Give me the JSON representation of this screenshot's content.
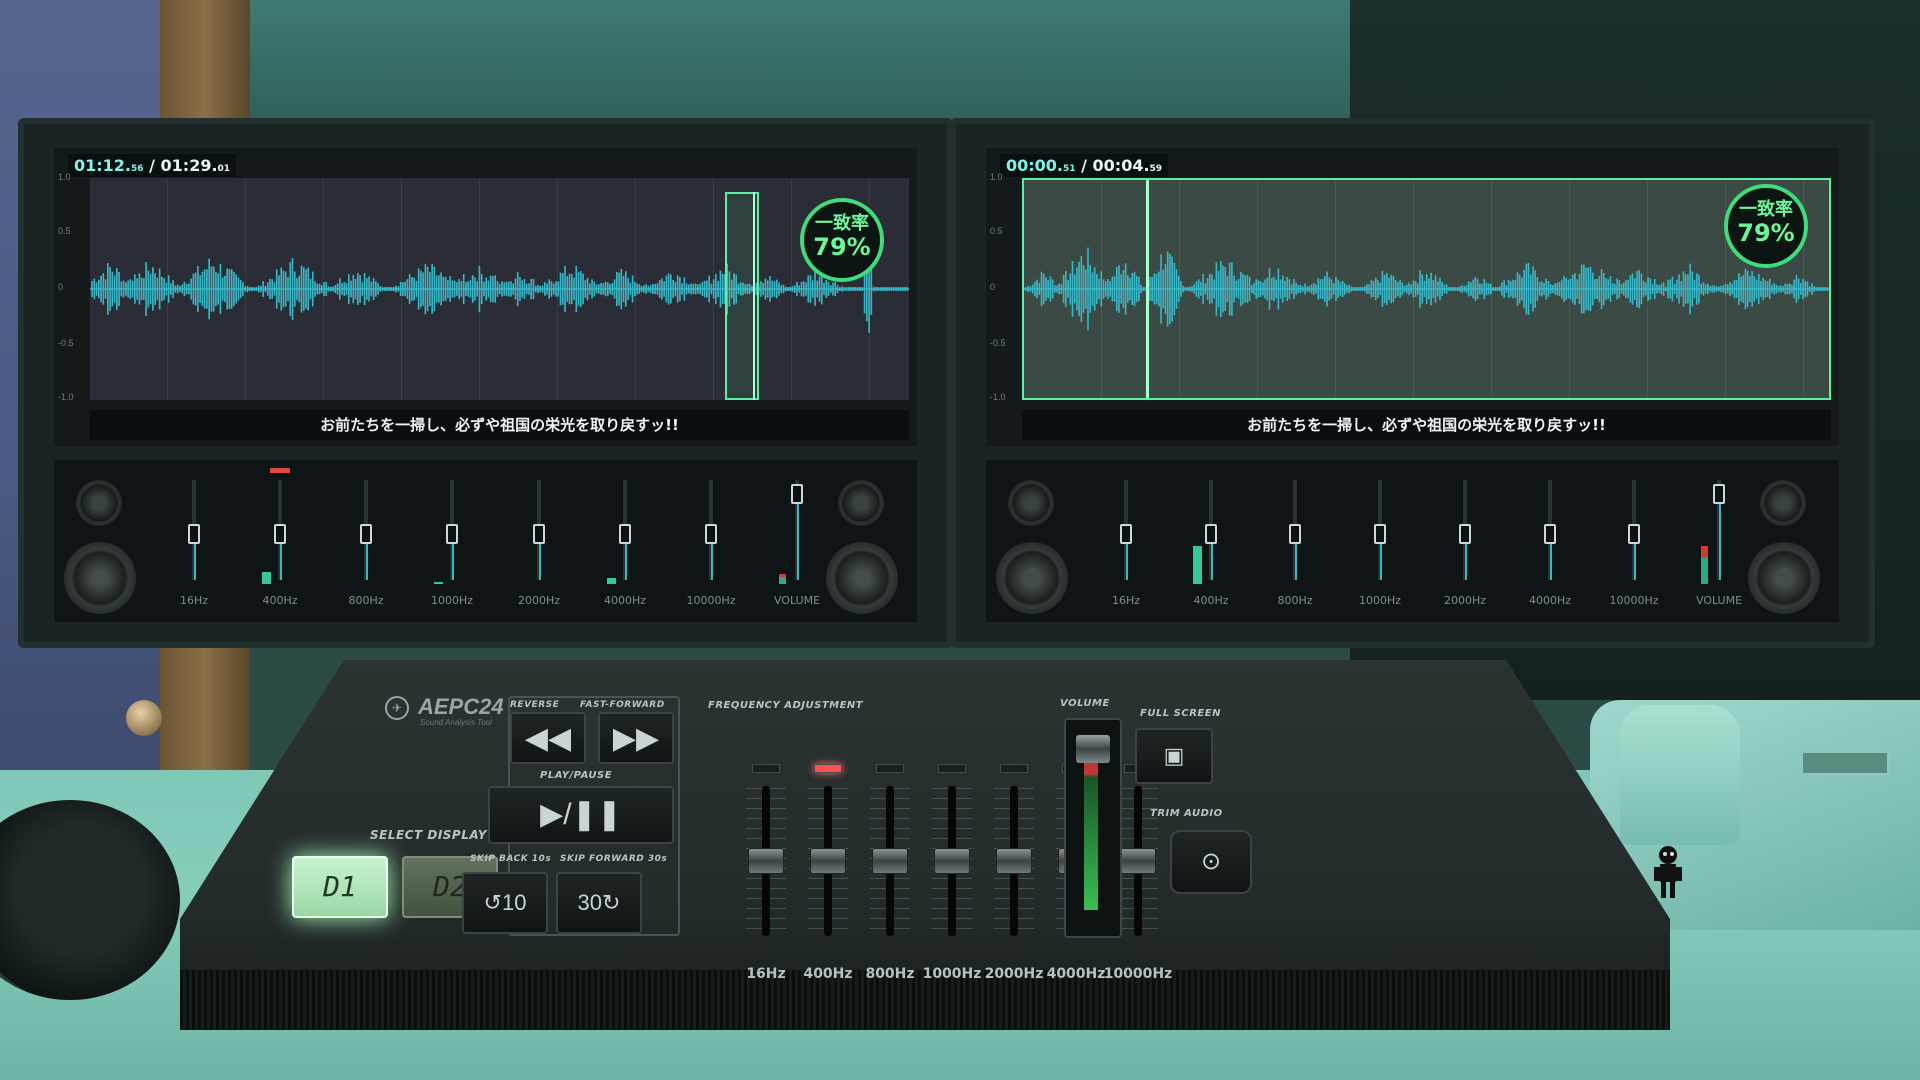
{
  "monitors": [
    {
      "timecode_current": "01:12.",
      "timecode_current_frac": "56",
      "timecode_total": "/ 01:29.",
      "timecode_total_frac": "01",
      "match_label": "一致率",
      "match_value": "79%",
      "y_ticks": [
        "1.0",
        "0.5",
        "0",
        "-0.5",
        "-1.0"
      ],
      "subtitle": "お前たちを一掃し、必ずや祖国の栄光を取り戻すッ!!",
      "faders": [
        {
          "label": "16Hz",
          "level": 0.5,
          "meter": 0.0,
          "led": false
        },
        {
          "label": "400Hz",
          "level": 0.5,
          "meter": 0.12,
          "led": true
        },
        {
          "label": "800Hz",
          "level": 0.5,
          "meter": 0.0,
          "led": false
        },
        {
          "label": "1000Hz",
          "level": 0.5,
          "meter": 0.02,
          "led": false
        },
        {
          "label": "2000Hz",
          "level": 0.5,
          "meter": 0.0,
          "led": false
        },
        {
          "label": "4000Hz",
          "level": 0.5,
          "meter": 0.06,
          "led": false
        },
        {
          "label": "10000Hz",
          "level": 0.5,
          "meter": 0.0,
          "led": false
        },
        {
          "label": "VOLUME",
          "level": 0.95,
          "meter": 0.1,
          "led": false
        }
      ]
    },
    {
      "timecode_current": "00:00.",
      "timecode_current_frac": "51",
      "timecode_total": "/ 00:04.",
      "timecode_total_frac": "59",
      "match_label": "一致率",
      "match_value": "79%",
      "y_ticks": [
        "1.0",
        "0.5",
        "0",
        "-0.5",
        "-1.0"
      ],
      "subtitle": "お前たちを一掃し、必ずや祖国の栄光を取り戻すッ!!",
      "faders": [
        {
          "label": "16Hz",
          "level": 0.5,
          "meter": 0.0,
          "led": false
        },
        {
          "label": "400Hz",
          "level": 0.5,
          "meter": 0.38,
          "led": false
        },
        {
          "label": "800Hz",
          "level": 0.5,
          "meter": 0.0,
          "led": false
        },
        {
          "label": "1000Hz",
          "level": 0.5,
          "meter": 0.0,
          "led": false
        },
        {
          "label": "2000Hz",
          "level": 0.5,
          "meter": 0.0,
          "led": false
        },
        {
          "label": "4000Hz",
          "level": 0.5,
          "meter": 0.0,
          "led": false
        },
        {
          "label": "10000Hz",
          "level": 0.5,
          "meter": 0.0,
          "led": false
        },
        {
          "label": "VOLUME",
          "level": 0.95,
          "meter": 0.38,
          "led": false
        }
      ]
    }
  ],
  "console": {
    "brand": "AEPC24",
    "brand_sub": "Sound Analysis Tool",
    "select_display_label": "SELECT DISPLAY",
    "display_buttons": [
      "D1",
      "D2"
    ],
    "active_display": "D1",
    "reverse_label": "REVERSE",
    "fast_forward_label": "FAST-FORWARD",
    "play_pause_label": "PLAY/PAUSE",
    "skip_back_label": "SKIP BACK 10s",
    "skip_forward_label": "SKIP FORWARD 30s",
    "skip_back_glyph": "10",
    "skip_forward_glyph": "30",
    "frequency_label": "FREQUENCY ADJUSTMENT",
    "volume_label": "VOLUME",
    "full_screen_label": "FULL SCREEN",
    "trim_audio_label": "TRIM AUDIO",
    "freq_faders": [
      {
        "label": "16Hz",
        "level": 0.5,
        "led": false
      },
      {
        "label": "400Hz",
        "level": 0.5,
        "led": true
      },
      {
        "label": "800Hz",
        "level": 0.5,
        "led": false
      },
      {
        "label": "1000Hz",
        "level": 0.5,
        "led": false
      },
      {
        "label": "2000Hz",
        "level": 0.5,
        "led": false
      },
      {
        "label": "4000Hz",
        "level": 0.5,
        "led": false
      },
      {
        "label": "10000Hz",
        "level": 0.5,
        "led": false
      }
    ],
    "volume_level": 0.95
  },
  "colors": {
    "waveform": "#3ab7c7",
    "selection": "#5bf0a0",
    "match_ring": "#3fdc7c",
    "led_active": "#ff5252"
  }
}
